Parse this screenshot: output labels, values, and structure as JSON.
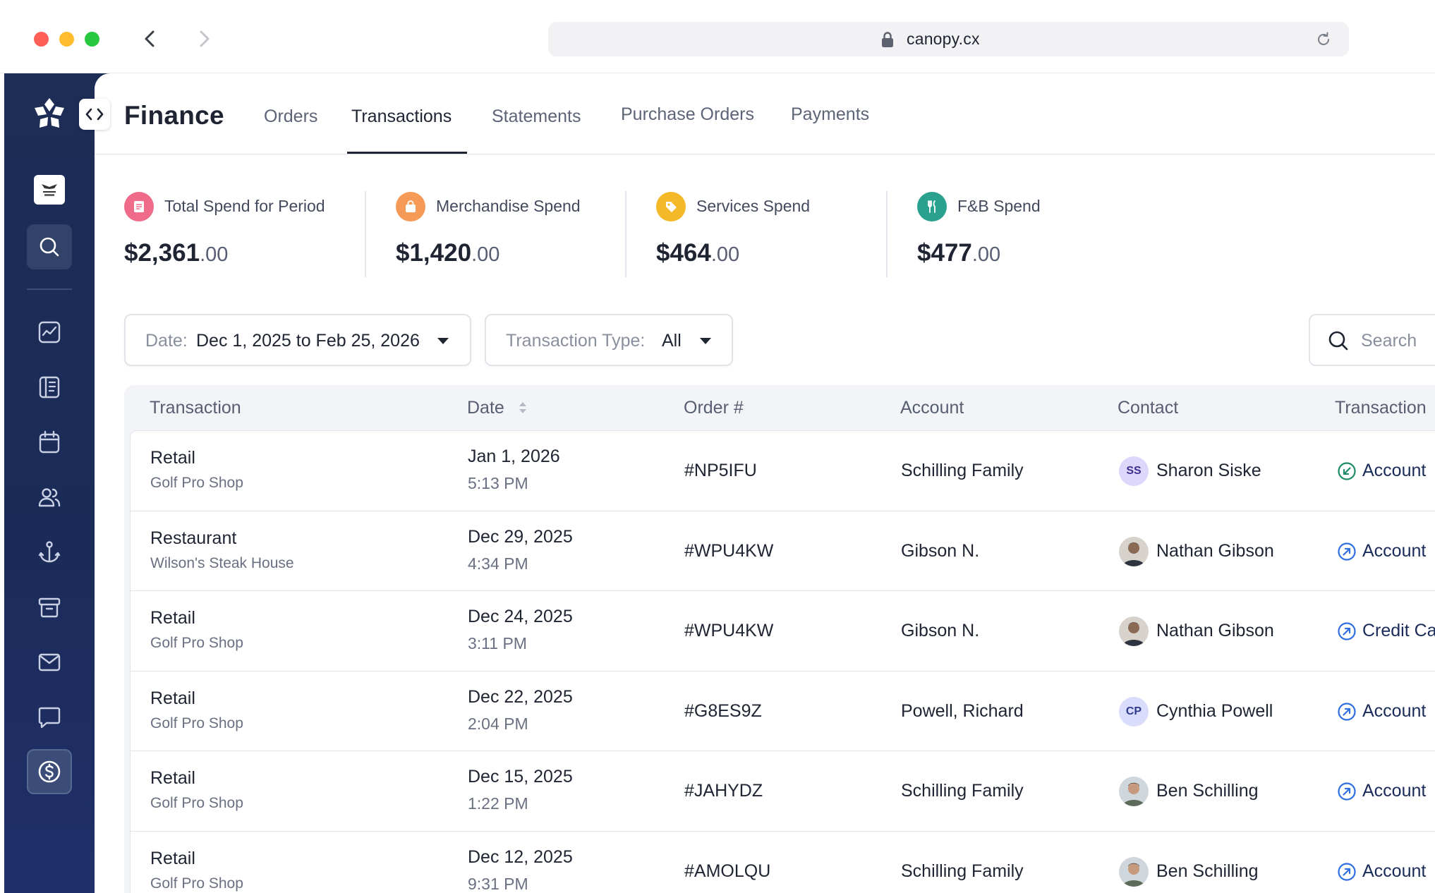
{
  "browser": {
    "url": "canopy.cx"
  },
  "sidebar": {
    "items": [
      {
        "name": "search-icon"
      },
      {
        "name": "analytics-icon"
      },
      {
        "name": "book-icon"
      },
      {
        "name": "calendar-icon"
      },
      {
        "name": "members-icon"
      },
      {
        "name": "anchor-icon"
      },
      {
        "name": "archive-icon"
      },
      {
        "name": "mail-icon"
      },
      {
        "name": "chat-icon"
      },
      {
        "name": "finance-icon",
        "active": true
      }
    ]
  },
  "header": {
    "title": "Finance",
    "tabs": [
      {
        "label": "Orders"
      },
      {
        "label": "Transactions",
        "active": true
      },
      {
        "label": "Statements"
      },
      {
        "label": "Purchase Orders"
      },
      {
        "label": "Payments"
      }
    ]
  },
  "stats": [
    {
      "label": "Total Spend for Period",
      "int": "$2,361",
      "dec": ".00",
      "icon": "receipt-icon",
      "color": "#ee6b8a"
    },
    {
      "label": "Merchandise Spend",
      "int": "$1,420",
      "dec": ".00",
      "icon": "shopping-bag-icon",
      "color": "#f59a57"
    },
    {
      "label": "Services Spend",
      "int": "$464",
      "dec": ".00",
      "icon": "tag-icon",
      "color": "#f5b829"
    },
    {
      "label": "F&B Spend",
      "int": "$477",
      "dec": ".00",
      "icon": "utensils-icon",
      "color": "#2aa18e"
    }
  ],
  "filters": {
    "date_label": "Date:",
    "date_value": "Dec 1, 2025 to Feb 25, 2026",
    "type_label": "Transaction Type:",
    "type_value": "All",
    "search_placeholder": "Search"
  },
  "table": {
    "headers": [
      "Transaction",
      "Date",
      "Order #",
      "Account",
      "Contact",
      "Transaction"
    ],
    "rows": [
      {
        "type": "Retail",
        "location": "Golf Pro Shop",
        "date": "Jan 1, 2026",
        "time": "5:13 PM",
        "order": "#NP5IFU",
        "account": "Schilling Family",
        "avatar": "SS",
        "contact": "Sharon Siske",
        "tx": "Account",
        "tx_icon": "arrow-in-circle-icon"
      },
      {
        "type": "Restaurant",
        "location": "Wilson's Steak House",
        "date": "Dec 29, 2025",
        "time": "4:34 PM",
        "order": "#WPU4KW",
        "account": "Gibson N.",
        "avatar": "",
        "contact": "Nathan Gibson",
        "tx": "Account",
        "tx_icon": "arrow-out-circle-icon"
      },
      {
        "type": "Retail",
        "location": "Golf Pro Shop",
        "date": "Dec 24, 2025",
        "time": "3:11 PM",
        "order": "#WPU4KW",
        "account": "Gibson N.",
        "avatar": "",
        "contact": "Nathan Gibson",
        "tx": "Credit Ca",
        "tx_icon": "arrow-out-circle-icon"
      },
      {
        "type": "Retail",
        "location": "Golf Pro Shop",
        "date": "Dec 22, 2025",
        "time": "2:04 PM",
        "order": "#G8ES9Z",
        "account": "Powell, Richard",
        "avatar": "CP",
        "contact": "Cynthia Powell",
        "tx": "Account",
        "tx_icon": "arrow-out-circle-icon"
      },
      {
        "type": "Retail",
        "location": "Golf Pro Shop",
        "date": "Dec 15, 2025",
        "time": "1:22 PM",
        "order": "#JAHYDZ",
        "account": "Schilling Family",
        "avatar": "",
        "contact": "Ben Schilling",
        "tx": "Account",
        "tx_icon": "arrow-out-circle-icon"
      },
      {
        "type": "Retail",
        "location": "Golf Pro Shop",
        "date": "Dec 12, 2025",
        "time": "9:31 PM",
        "order": "#AMOLQU",
        "account": "Schilling Family",
        "avatar": "",
        "contact": "Ben Schilling",
        "tx": "Account",
        "tx_icon": "arrow-out-circle-icon"
      }
    ]
  },
  "colors": {
    "sidebar": "#1d2d55",
    "accent": "#1b2b59",
    "incoming": "#1e8a6a",
    "outgoing": "#2f6fe0"
  }
}
